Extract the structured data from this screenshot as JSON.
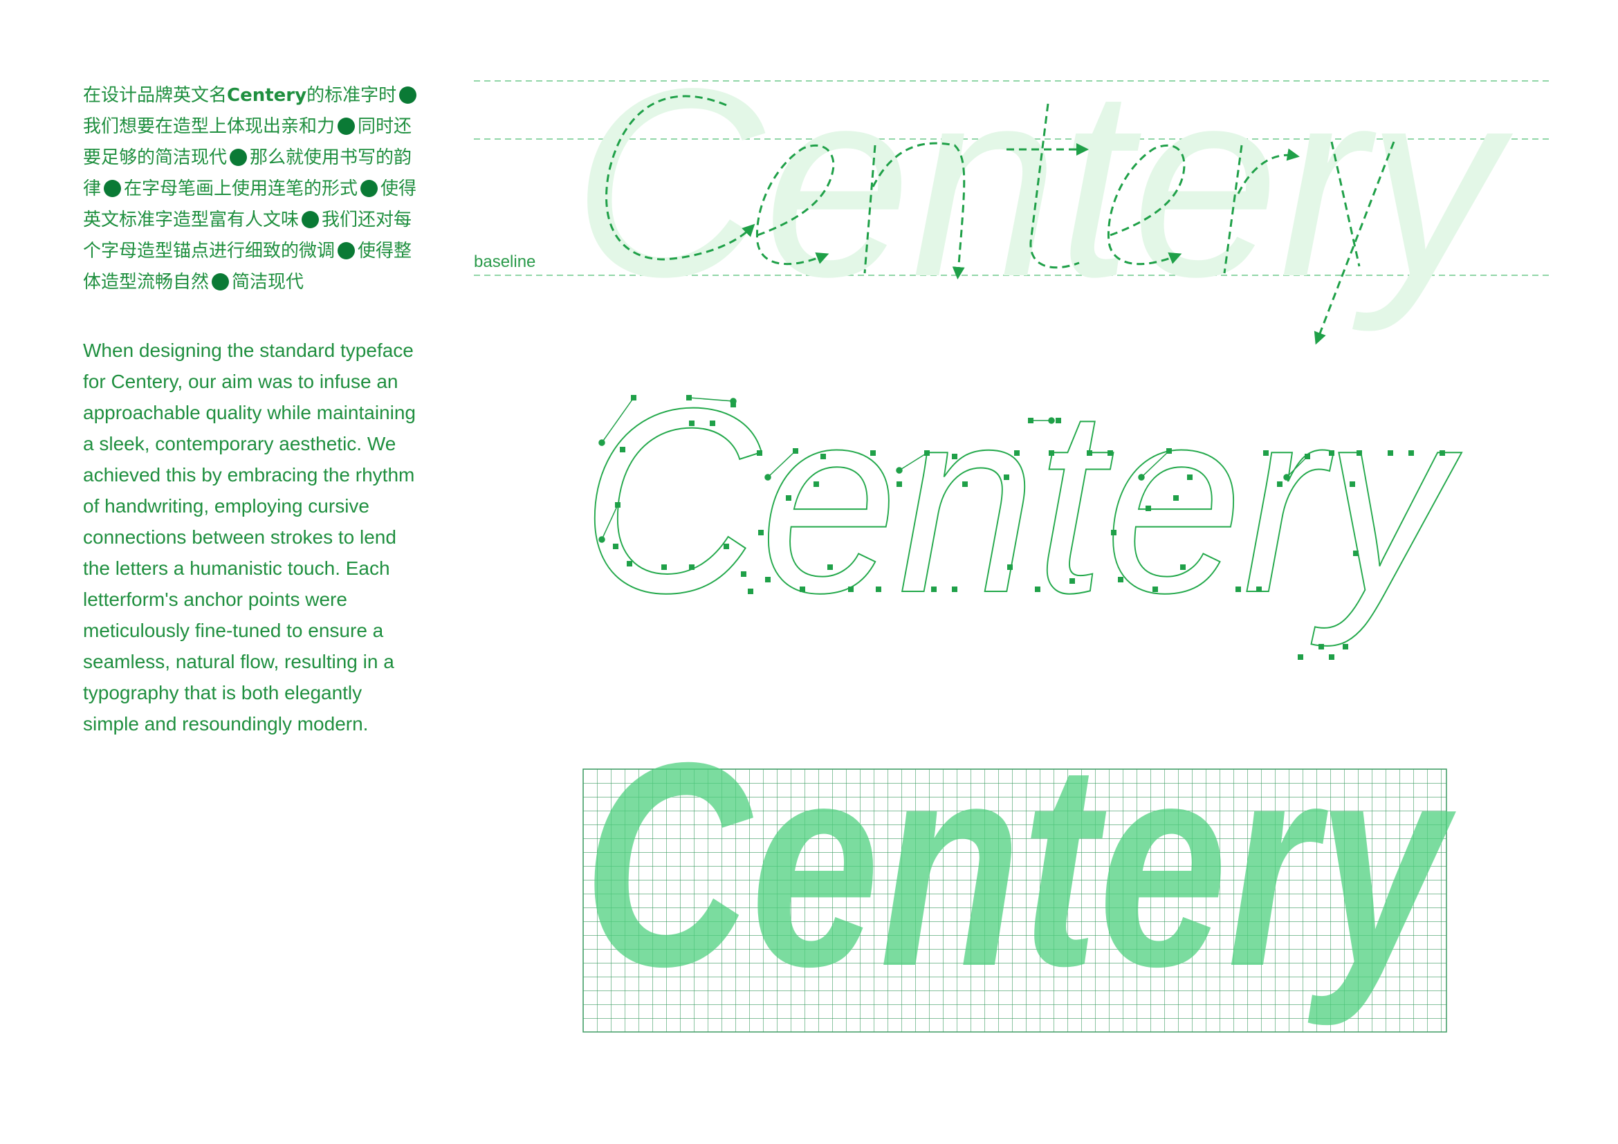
{
  "cn_paragraph": {
    "seg1": "在设计品牌英文名",
    "brand": "Centery",
    "seg2": "的标准字时",
    "seg3": "我们想要在造型上体现出亲和力",
    "seg4": "同时还要足够的简洁现代",
    "seg5": "那么就使用书写的韵律",
    "seg6": "在字母笔画上使用连笔的形式",
    "seg7": "使得英文标准字造型富有人文味",
    "seg8": "我们还对每个字母造型锚点进行细致的微调",
    "seg9": "使得整体造型流畅自然",
    "seg10": "简洁现代"
  },
  "en_paragraph": "When designing the standard type­face for Centery, our aim was to infuse an approachable quality while maintaining a sleek, contemporary aesthetic. We achieved this by embracing the rhythm of handwriting, employing cursive connections between strokes to lend the letters a humanistic touch. Each letterform's anchor points were meticulously fine-tuned to ensure a seamless, natural flow, resulting in a typography that is both elegantly simple and resoundingly modern.",
  "baseline_label": "baseline",
  "wordmark": "Centery",
  "colors": {
    "green_text": "#1f8f3f",
    "dot": "#0a7a35",
    "light_fill": "#e3f7e7",
    "outline": "#22a84a",
    "solid_fill": "#4fd07f",
    "grid": "#3d9c62"
  }
}
